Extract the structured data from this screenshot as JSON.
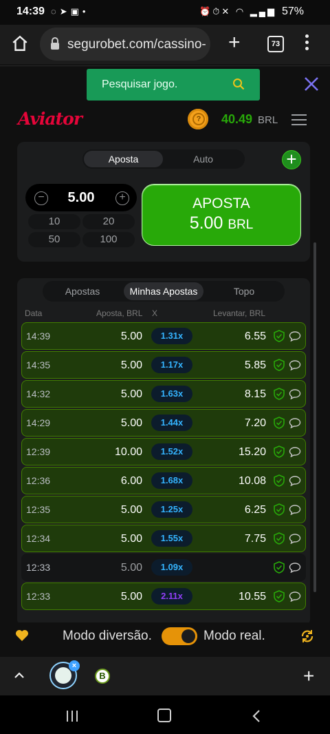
{
  "status_bar": {
    "time": "14:39",
    "battery": "57%"
  },
  "browser": {
    "url": "segurobet.com/cassino-",
    "tab_count": "73"
  },
  "search": {
    "placeholder": "Pesquisar jogo."
  },
  "game": {
    "logo": "Aviator",
    "balance": "40.49",
    "currency": "BRL"
  },
  "bet_panel": {
    "modes": [
      "Aposta",
      "Auto"
    ],
    "active_mode": "Aposta",
    "amount": "5.00",
    "quick_amounts": [
      "10",
      "20",
      "50",
      "100"
    ],
    "bet_button_label": "APOSTA",
    "bet_button_amount": "5.00",
    "bet_button_currency": "BRL"
  },
  "history": {
    "tabs": [
      "Apostas",
      "Minhas Apostas",
      "Topo"
    ],
    "active_tab": "Minhas Apostas",
    "columns": {
      "date": "Data",
      "bet": "Aposta, BRL",
      "mult": "X",
      "cashout": "Levantar, BRL"
    },
    "rows": [
      {
        "time": "14:39",
        "bet": "5.00",
        "mult": "1.31x",
        "payout": "6.55",
        "win": true,
        "mult_color": "#34b4ff"
      },
      {
        "time": "14:35",
        "bet": "5.00",
        "mult": "1.17x",
        "payout": "5.85",
        "win": true,
        "mult_color": "#34b4ff"
      },
      {
        "time": "14:32",
        "bet": "5.00",
        "mult": "1.63x",
        "payout": "8.15",
        "win": true,
        "mult_color": "#34b4ff"
      },
      {
        "time": "14:29",
        "bet": "5.00",
        "mult": "1.44x",
        "payout": "7.20",
        "win": true,
        "mult_color": "#34b4ff"
      },
      {
        "time": "12:39",
        "bet": "10.00",
        "mult": "1.52x",
        "payout": "15.20",
        "win": true,
        "mult_color": "#34b4ff"
      },
      {
        "time": "12:36",
        "bet": "6.00",
        "mult": "1.68x",
        "payout": "10.08",
        "win": true,
        "mult_color": "#34b4ff"
      },
      {
        "time": "12:35",
        "bet": "5.00",
        "mult": "1.25x",
        "payout": "6.25",
        "win": true,
        "mult_color": "#34b4ff"
      },
      {
        "time": "12:34",
        "bet": "5.00",
        "mult": "1.55x",
        "payout": "7.75",
        "win": true,
        "mult_color": "#34b4ff"
      },
      {
        "time": "12:33",
        "bet": "5.00",
        "mult": "1.09x",
        "payout": "",
        "win": false,
        "mult_color": "#34b4ff"
      },
      {
        "time": "12:33",
        "bet": "5.00",
        "mult": "2.11x",
        "payout": "10.55",
        "win": true,
        "mult_color": "#913ef8"
      }
    ]
  },
  "footer": {
    "mode_fun": "Modo diversão.",
    "mode_real": "Modo real."
  },
  "colors": {
    "accent_green": "#28a909",
    "search_green": "#189a57",
    "logo_red": "#e50539",
    "toggle_orange": "#e69308"
  }
}
